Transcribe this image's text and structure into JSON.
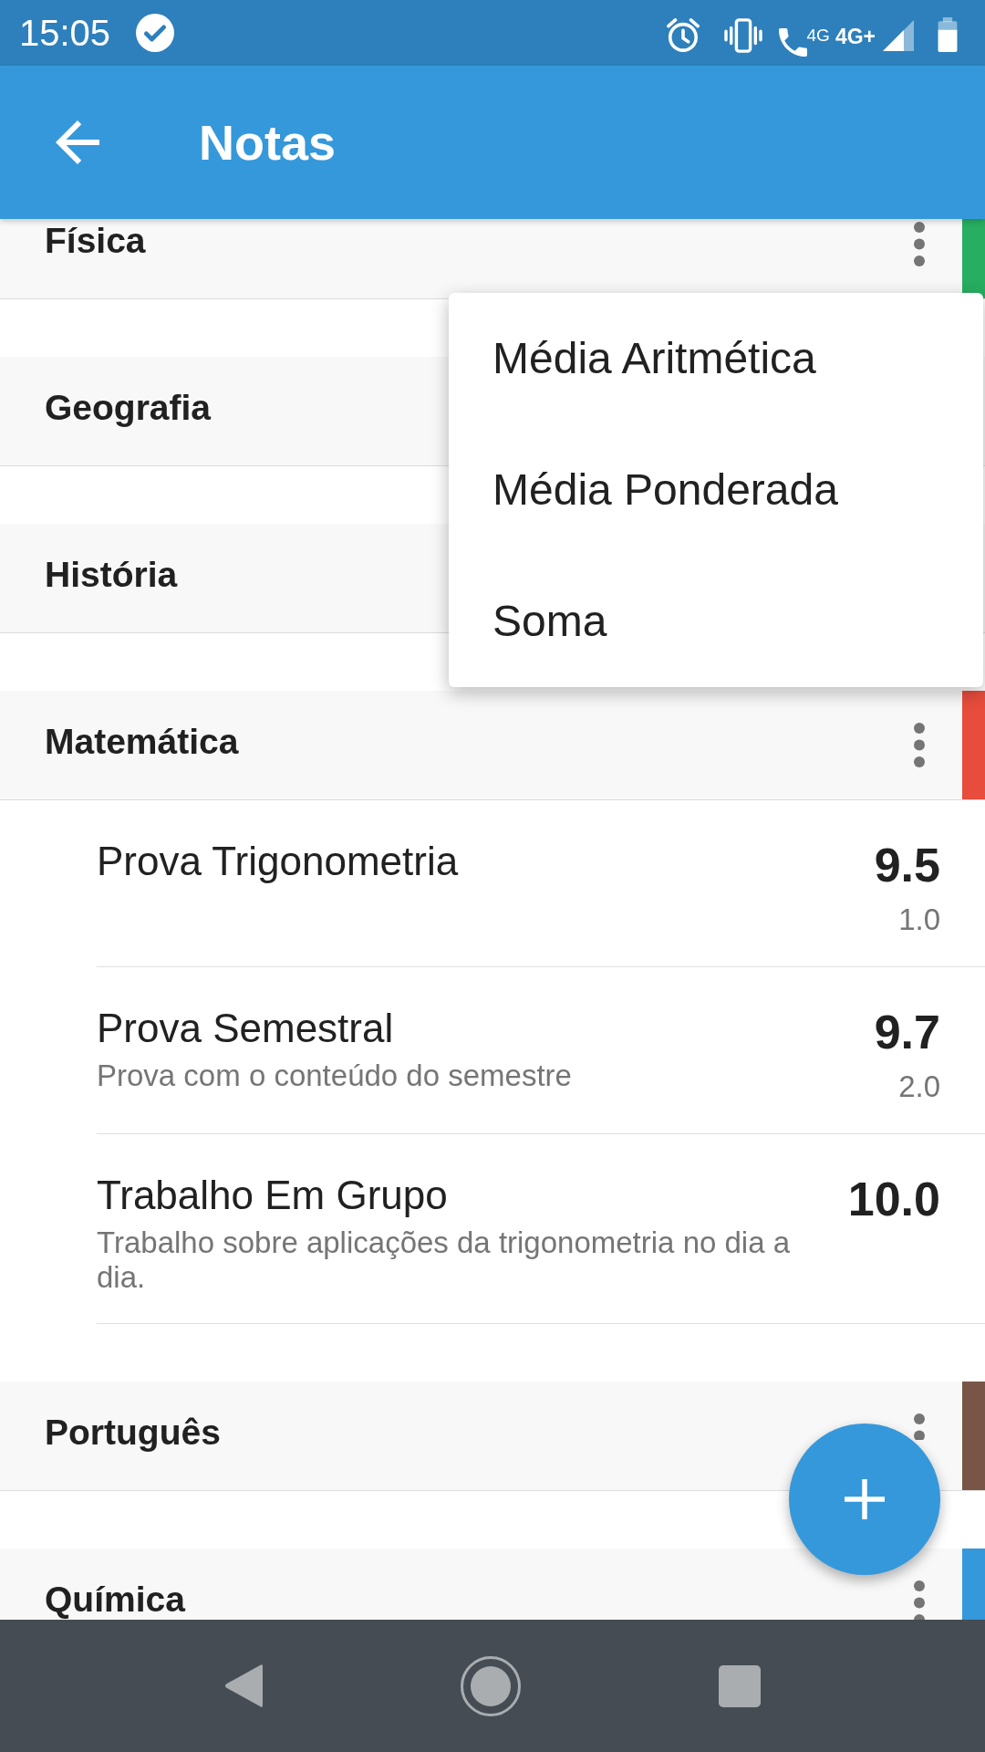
{
  "status_bar": {
    "time": "15:05",
    "call_network": "4G",
    "network": "4G+"
  },
  "app_bar": {
    "title": "Notas"
  },
  "subjects": [
    {
      "name": "Física",
      "color": "#27ae60"
    },
    {
      "name": "Geografia"
    },
    {
      "name": "História"
    },
    {
      "name": "Matemática",
      "color": "#e74c3c",
      "grades": [
        {
          "title": "Prova Trigonometria",
          "value": "9.5",
          "weight": "1.0"
        },
        {
          "title": "Prova Semestral",
          "description": "Prova com o conteúdo do semestre",
          "value": "9.7",
          "weight": "2.0"
        },
        {
          "title": "Trabalho Em Grupo",
          "description": "Trabalho sobre aplicações da trigonometria no dia a dia.",
          "value": "10.0"
        }
      ]
    },
    {
      "name": "Português",
      "color": "#795548"
    },
    {
      "name": "Química",
      "color": "#3498db"
    }
  ],
  "menu": [
    "Média Aritmética",
    "Média Ponderada",
    "Soma"
  ]
}
